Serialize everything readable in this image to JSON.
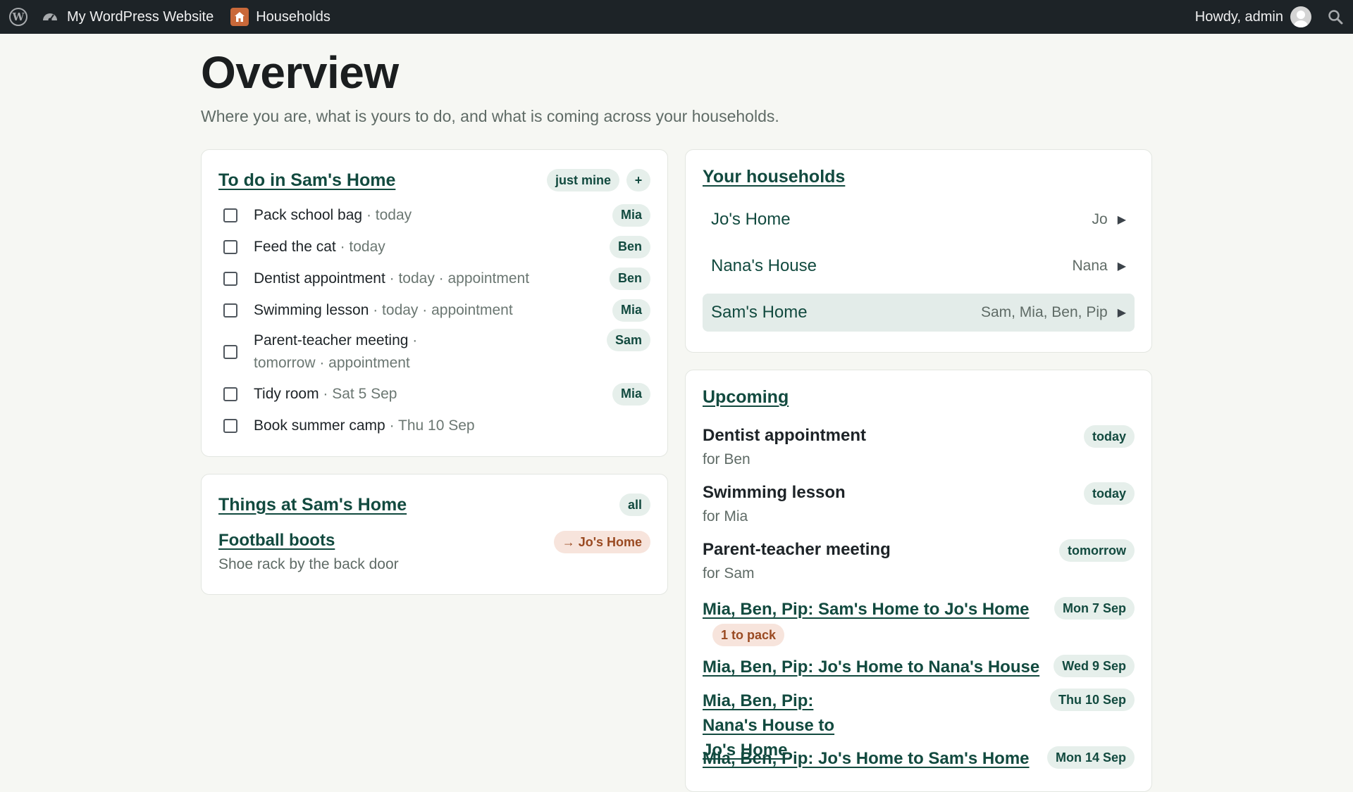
{
  "adminbar": {
    "site_name": "My WordPress Website",
    "households_label": "Households",
    "howdy": "Howdy, admin",
    "icons": [
      "wordpress-logo-icon",
      "dashboard-icon",
      "house-icon",
      "avatar",
      "search-icon"
    ]
  },
  "page": {
    "title": "Overview",
    "subtitle": "Where you are, what is yours to do, and what is coming across your households."
  },
  "todo": {
    "title": "To do in Sam's Home",
    "filter_label": "just mine",
    "add_label": "+",
    "items": [
      {
        "name": "Pack school bag",
        "meta": " · today",
        "assignee": "Mia"
      },
      {
        "name": "Feed the cat",
        "meta": " · today",
        "assignee": "Ben"
      },
      {
        "name": "Dentist appointment",
        "meta": " · today · appointment",
        "assignee": "Ben"
      },
      {
        "name": "Swimming lesson",
        "meta": " · today · appointment",
        "assignee": "Mia"
      },
      {
        "name": "Parent-teacher meeting",
        "meta": " · tomorrow · appointment",
        "assignee": "Sam"
      },
      {
        "name": "Tidy room",
        "meta": " · Sat 5 Sep",
        "assignee": "Mia"
      },
      {
        "name": "Book summer camp",
        "meta": " · Thu 10 Sep",
        "assignee": ""
      }
    ]
  },
  "things": {
    "title": "Things at Sam's Home",
    "filter_label": "all",
    "items": [
      {
        "name": "Football boots",
        "location": "Shoe rack by the back door",
        "moving_to": "→ Jo's Home"
      }
    ]
  },
  "households": {
    "title": "Your households",
    "items": [
      {
        "name": "Jo's Home",
        "members": "Jo",
        "arrow": "▶",
        "active": false
      },
      {
        "name": "Nana's House",
        "members": "Nana",
        "arrow": "▶",
        "active": false
      },
      {
        "name": "Sam's Home",
        "members": "Sam, Mia, Ben, Pip",
        "arrow": "▶",
        "active": true
      }
    ]
  },
  "upcoming": {
    "title": "Upcoming",
    "items": [
      {
        "name": "Dentist appointment",
        "sub": "for Ben",
        "date": "today",
        "link": false
      },
      {
        "name": "Swimming lesson",
        "sub": "for Mia",
        "date": "today",
        "link": false
      },
      {
        "name": "Parent-teacher meeting",
        "sub": "for Sam",
        "date": "tomorrow",
        "link": false
      },
      {
        "name": "Mia, Ben, Pip: Sam's Home to Jo's Home",
        "badge": "1 to pack",
        "date": "Mon 7 Sep",
        "link": true
      },
      {
        "name": "Mia, Ben, Pip: Jo's Home to Nana's House",
        "date": "Wed 9 Sep",
        "link": true
      },
      {
        "name": "Mia, Ben, Pip: Nana's House to Jo's Home",
        "date": "Thu 10 Sep",
        "link": true
      },
      {
        "name": "Mia, Ben, Pip: Jo's Home to Sam's Home",
        "date": "Mon 14 Sep",
        "link": true
      }
    ]
  },
  "colors": {
    "adminbar_bg": "#1d2327",
    "page_bg": "#f6f7f3",
    "accent": "#124a3f",
    "pill_bg": "#e6efeb",
    "warm_pill_bg": "#f7e4dc",
    "warm_pill_text": "#9a4a22"
  }
}
